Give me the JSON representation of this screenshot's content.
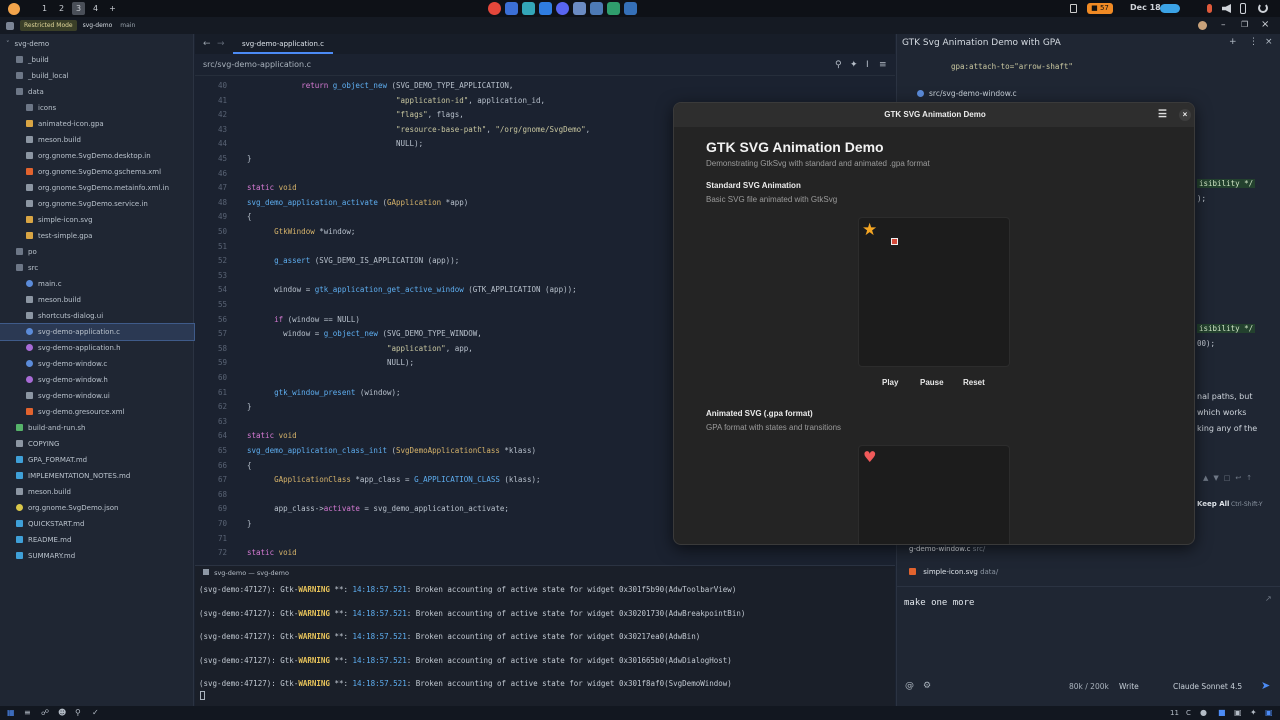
{
  "topbar": {
    "workspaces": [
      "1",
      "2",
      "3",
      "4",
      "+"
    ],
    "battery": "■ 57",
    "clock": "Dec 18"
  },
  "idehead": {
    "restricted": "Restricted Mode",
    "project": "svg-demo",
    "branch": "main"
  },
  "sidebar": {
    "items": [
      {
        "label": "svg-demo",
        "icon": "chevron",
        "indent": 0
      },
      {
        "label": "_build",
        "icon": "folder",
        "indent": 1
      },
      {
        "label": "_build_local",
        "icon": "folder",
        "indent": 1
      },
      {
        "label": "data",
        "icon": "folder",
        "indent": 1
      },
      {
        "label": "icons",
        "icon": "folder",
        "indent": 2
      },
      {
        "label": "animated-icon.gpa",
        "icon": "file",
        "indent": 2
      },
      {
        "label": "meson.build",
        "icon": "doc",
        "indent": 2
      },
      {
        "label": "org.gnome.SvgDemo.desktop.in",
        "icon": "doc",
        "indent": 2
      },
      {
        "label": "org.gnome.SvgDemo.gschema.xml",
        "icon": "xml",
        "indent": 2
      },
      {
        "label": "org.gnome.SvgDemo.metainfo.xml.in",
        "icon": "doc",
        "indent": 2
      },
      {
        "label": "org.gnome.SvgDemo.service.in",
        "icon": "doc",
        "indent": 2
      },
      {
        "label": "simple-icon.svg",
        "icon": "file",
        "indent": 2
      },
      {
        "label": "test-simple.gpa",
        "icon": "file",
        "indent": 2
      },
      {
        "label": "po",
        "icon": "folder",
        "indent": 1
      },
      {
        "label": "src",
        "icon": "folder",
        "indent": 1
      },
      {
        "label": "main.c",
        "icon": "c",
        "indent": 2
      },
      {
        "label": "meson.build",
        "icon": "doc",
        "indent": 2
      },
      {
        "label": "shortcuts-dialog.ui",
        "icon": "doc",
        "indent": 2
      },
      {
        "label": "svg-demo-application.c",
        "icon": "c",
        "indent": 2,
        "selected": true
      },
      {
        "label": "svg-demo-application.h",
        "icon": "h",
        "indent": 2
      },
      {
        "label": "svg-demo-window.c",
        "icon": "c",
        "indent": 2
      },
      {
        "label": "svg-demo-window.h",
        "icon": "h",
        "indent": 2
      },
      {
        "label": "svg-demo-window.ui",
        "icon": "doc",
        "indent": 2
      },
      {
        "label": "svg-demo.gresource.xml",
        "icon": "xml",
        "indent": 2
      },
      {
        "label": "build-and-run.sh",
        "icon": "sh",
        "indent": 1
      },
      {
        "label": "COPYING",
        "icon": "doc",
        "indent": 1
      },
      {
        "label": "GPA_FORMAT.md",
        "icon": "md",
        "indent": 1
      },
      {
        "label": "IMPLEMENTATION_NOTES.md",
        "icon": "md",
        "indent": 1
      },
      {
        "label": "meson.build",
        "icon": "doc",
        "indent": 1
      },
      {
        "label": "org.gnome.SvgDemo.json",
        "icon": "json",
        "indent": 1
      },
      {
        "label": "QUICKSTART.md",
        "icon": "md",
        "indent": 1
      },
      {
        "label": "README.md",
        "icon": "md",
        "indent": 1
      },
      {
        "label": "SUMMARY.md",
        "icon": "md",
        "indent": 1
      }
    ]
  },
  "editor": {
    "tab": "svg-demo-application.c",
    "path": "src/svg-demo-application.c",
    "lines": [
      {
        "n": "40",
        "t": [
          [
            "pl",
            "            "
          ],
          [
            "kw",
            "return"
          ],
          [
            "pl",
            " "
          ],
          [
            "fn",
            "g_object_new"
          ],
          [
            "pl",
            " (SVG_DEMO_TYPE_APPLICATION,"
          ]
        ]
      },
      {
        "n": "41",
        "t": [
          [
            "pl",
            "                                 "
          ],
          [
            "str",
            "\"application-id\""
          ],
          [
            "pl",
            ", application_id,"
          ]
        ]
      },
      {
        "n": "42",
        "t": [
          [
            "pl",
            "                                 "
          ],
          [
            "str",
            "\"flags\""
          ],
          [
            "pl",
            ", flags,"
          ]
        ]
      },
      {
        "n": "43",
        "t": [
          [
            "pl",
            "                                 "
          ],
          [
            "str",
            "\"resource-base-path\""
          ],
          [
            "pl",
            ", "
          ],
          [
            "str",
            "\"/org/gnome/SvgDemo\""
          ],
          [
            "pl",
            ","
          ]
        ]
      },
      {
        "n": "44",
        "t": [
          [
            "pl",
            "                                 NULL);"
          ]
        ]
      },
      {
        "n": "45",
        "t": [
          [
            "pl",
            "}"
          ]
        ]
      },
      {
        "n": "46",
        "t": [
          [
            "pl",
            ""
          ]
        ]
      },
      {
        "n": "47",
        "t": [
          [
            "kw",
            "static"
          ],
          [
            "pl",
            " "
          ],
          [
            "ty",
            "void"
          ]
        ]
      },
      {
        "n": "48",
        "t": [
          [
            "fn",
            "svg_demo_application_activate"
          ],
          [
            "pl",
            " ("
          ],
          [
            "ty",
            "GApplication"
          ],
          [
            "pl",
            " *app)"
          ]
        ]
      },
      {
        "n": "49",
        "t": [
          [
            "pl",
            "{"
          ]
        ]
      },
      {
        "n": "50",
        "t": [
          [
            "pl",
            "      "
          ],
          [
            "ty",
            "GtkWindow"
          ],
          [
            "pl",
            " *window;"
          ]
        ]
      },
      {
        "n": "51",
        "t": [
          [
            "pl",
            ""
          ]
        ]
      },
      {
        "n": "52",
        "t": [
          [
            "pl",
            "      "
          ],
          [
            "fn",
            "g_assert"
          ],
          [
            "pl",
            " (SVG_DEMO_IS_APPLICATION (app));"
          ]
        ]
      },
      {
        "n": "53",
        "t": [
          [
            "pl",
            ""
          ]
        ]
      },
      {
        "n": "54",
        "t": [
          [
            "pl",
            "      window = "
          ],
          [
            "fn",
            "gtk_application_get_active_window"
          ],
          [
            "pl",
            " (GTK_APPLICATION (app));"
          ]
        ]
      },
      {
        "n": "55",
        "t": [
          [
            "pl",
            ""
          ]
        ]
      },
      {
        "n": "56",
        "t": [
          [
            "pl",
            "      "
          ],
          [
            "kw",
            "if"
          ],
          [
            "pl",
            " (window == NULL)"
          ]
        ]
      },
      {
        "n": "57",
        "t": [
          [
            "pl",
            "        window = "
          ],
          [
            "fn",
            "g_object_new"
          ],
          [
            "pl",
            " (SVG_DEMO_TYPE_WINDOW,"
          ]
        ]
      },
      {
        "n": "58",
        "t": [
          [
            "pl",
            "                               "
          ],
          [
            "str",
            "\"application\""
          ],
          [
            "pl",
            ", app,"
          ]
        ]
      },
      {
        "n": "59",
        "t": [
          [
            "pl",
            "                               NULL);"
          ]
        ]
      },
      {
        "n": "60",
        "t": [
          [
            "pl",
            ""
          ]
        ]
      },
      {
        "n": "61",
        "t": [
          [
            "pl",
            "      "
          ],
          [
            "fn",
            "gtk_window_present"
          ],
          [
            "pl",
            " (window);"
          ]
        ]
      },
      {
        "n": "62",
        "t": [
          [
            "pl",
            "}"
          ]
        ]
      },
      {
        "n": "63",
        "t": [
          [
            "pl",
            ""
          ]
        ]
      },
      {
        "n": "64",
        "t": [
          [
            "kw",
            "static"
          ],
          [
            "pl",
            " "
          ],
          [
            "ty",
            "void"
          ]
        ]
      },
      {
        "n": "65",
        "t": [
          [
            "fn",
            "svg_demo_application_class_init"
          ],
          [
            "pl",
            " ("
          ],
          [
            "ty",
            "SvgDemoApplicationClass"
          ],
          [
            "pl",
            " *klass)"
          ]
        ]
      },
      {
        "n": "66",
        "t": [
          [
            "pl",
            "{"
          ]
        ]
      },
      {
        "n": "67",
        "t": [
          [
            "pl",
            "      "
          ],
          [
            "ty",
            "GApplicationClass"
          ],
          [
            "pl",
            " *app_class = "
          ],
          [
            "fn",
            "G_APPLICATION_CLASS"
          ],
          [
            "pl",
            " (klass);"
          ]
        ]
      },
      {
        "n": "68",
        "t": [
          [
            "pl",
            ""
          ]
        ]
      },
      {
        "n": "69",
        "t": [
          [
            "pl",
            "      app_class->"
          ],
          [
            "kw",
            "activate"
          ],
          [
            "pl",
            " = svg_demo_application_activate;"
          ]
        ]
      },
      {
        "n": "70",
        "t": [
          [
            "pl",
            "}"
          ]
        ]
      },
      {
        "n": "71",
        "t": [
          [
            "pl",
            ""
          ]
        ]
      },
      {
        "n": "72",
        "t": [
          [
            "kw",
            "static"
          ],
          [
            "pl",
            " "
          ],
          [
            "ty",
            "void"
          ]
        ]
      }
    ]
  },
  "terminal": {
    "tab": "svg-demo — svg-demo",
    "lines": [
      {
        "pre": "(svg-demo:47127): Gtk-",
        "warn": "WARNING",
        "mid": " **: ",
        "ts": "14:18:57.521",
        "msg": ": Broken accounting of active state for widget 0x301f5b90(AdwToolbarView)"
      },
      {
        "pre": "(svg-demo:47127): Gtk-",
        "warn": "WARNING",
        "mid": " **: ",
        "ts": "14:18:57.521",
        "msg": ": Broken accounting of active state for widget 0x30201730(AdwBreakpointBin)"
      },
      {
        "pre": "(svg-demo:47127): Gtk-",
        "warn": "WARNING",
        "mid": " **: ",
        "ts": "14:18:57.521",
        "msg": ": Broken accounting of active state for widget 0x30217ea0(AdwBin)"
      },
      {
        "pre": "(svg-demo:47127): Gtk-",
        "warn": "WARNING",
        "mid": " **: ",
        "ts": "14:18:57.521",
        "msg": ": Broken accounting of active state for widget 0x301665b0(AdwDialogHost)"
      },
      {
        "pre": "(svg-demo:47127): Gtk-",
        "warn": "WARNING",
        "mid": " **: ",
        "ts": "14:18:57.521",
        "msg": ": Broken accounting of active state for widget 0x301f8af0(SvgDemoWindow)"
      }
    ]
  },
  "chat": {
    "title": "GTK Svg Animation Demo with GPA",
    "snippet": "gpa:attach-to=\"arrow-shaft\"",
    "file_ref": "src/svg-demo-window.c",
    "diff_1": "isibility */",
    "diff_2": ");",
    "diff_3": "isibility */",
    "diff_4": "00);",
    "text_1": "nal paths, but",
    "text_2": "which works",
    "text_3": "king any of the",
    "keep_all": "Keep All",
    "keep_shortcut": "Ctrl-Shift-Y",
    "ctx_file_1": "g-demo-window.c",
    "ctx_dir_1": "src/",
    "ctx_file_2": "simple-icon.svg",
    "ctx_dir_2": "data/",
    "input": "make one more",
    "tokens": "80k / 200k",
    "mode": "Write",
    "model": "Claude Sonnet 4.5"
  },
  "gtk": {
    "title": "GTK SVG Animation Demo",
    "heading": "GTK SVG Animation Demo",
    "subtitle": "Demonstrating GtkSvg with standard and animated .gpa format",
    "section1_title": "Standard SVG Animation",
    "section1_sub": "Basic SVG file animated with GtkSvg",
    "play": "Play",
    "pause": "Pause",
    "reset": "Reset",
    "section2_title": "Animated SVG (.gpa format)",
    "section2_sub": "GPA format with states and transitions"
  },
  "statusbar": {
    "position": "11",
    "lang": "C"
  },
  "colors": {
    "accent": "#4c8bf5",
    "warning": "#e7c35a",
    "star": "#f5a623",
    "heart": "#f05a5a"
  }
}
